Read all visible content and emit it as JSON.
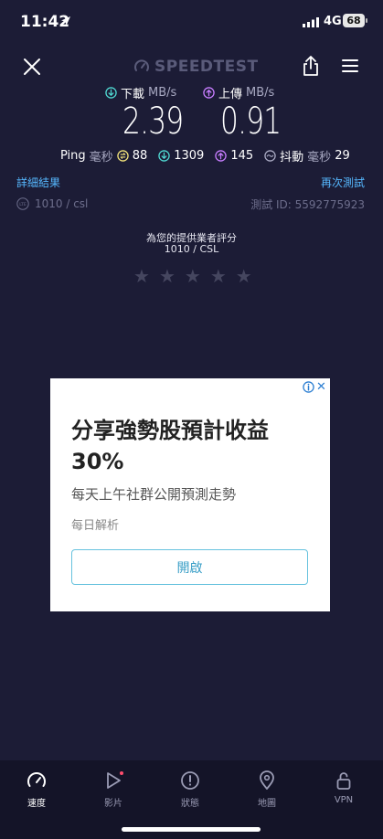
{
  "status_bar": {
    "time": "11:42",
    "network": "4G",
    "battery": "68"
  },
  "header": {
    "brand": "SPEEDTEST"
  },
  "metrics": {
    "download": {
      "label": "下載",
      "unit": "MB/s",
      "value": "2.39"
    },
    "upload": {
      "label": "上傳",
      "unit": "MB/s",
      "value": "0.91"
    }
  },
  "ping": {
    "label": "Ping",
    "unit": "毫秒",
    "idle": "88",
    "down": "1309",
    "up": "145",
    "jitter_label": "抖動",
    "jitter_unit": "毫秒",
    "jitter": "29"
  },
  "links": {
    "details": "詳細結果",
    "retest": "再次測試"
  },
  "provider": {
    "name": "1010 / csl",
    "test_id": "測試 ID: 5592775923"
  },
  "rating": {
    "prompt": "為您的提供業者評分",
    "isp": "1010 / CSL",
    "stars_filled": 0,
    "stars_total": 5
  },
  "ad": {
    "headline": "分享強勢股預計收益30%",
    "subtext": "每天上午社群公開預測走勢",
    "source": "每日解析",
    "cta": "開啟"
  },
  "nav": {
    "items": [
      {
        "label": "速度",
        "icon": "speedometer-icon"
      },
      {
        "label": "影片",
        "icon": "play-icon"
      },
      {
        "label": "狀態",
        "icon": "alert-icon"
      },
      {
        "label": "地圖",
        "icon": "map-pin-icon"
      },
      {
        "label": "VPN",
        "icon": "lock-icon"
      }
    ]
  },
  "colors": {
    "background": "#1c1c36",
    "download_accent": "#4fd6d0",
    "upload_accent": "#c77dff",
    "link": "#56b8ff"
  }
}
